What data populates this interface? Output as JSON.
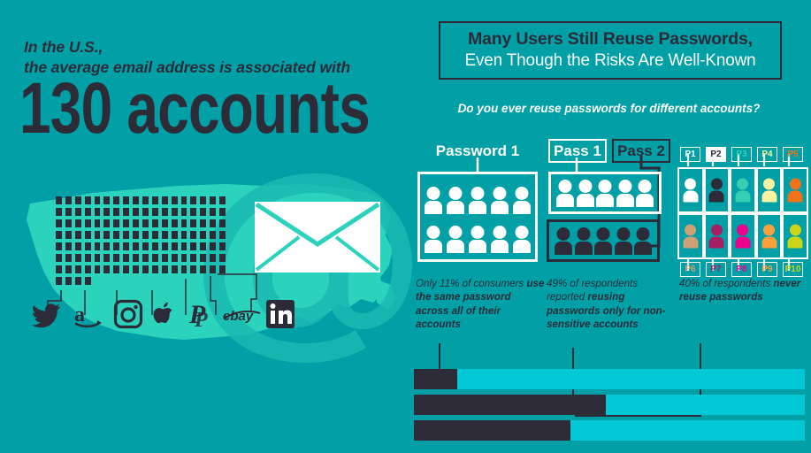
{
  "colors": {
    "background_teal": "#00a0a6",
    "map_teal": "#2bd3bd",
    "dark": "#2e2b38",
    "white": "#ffffff",
    "bar_track": "#00c8d4",
    "bar_fill": "#2e2b38"
  },
  "left": {
    "lede_line1": "In the U.S.,",
    "lede_line2": "the average email address is associated with",
    "big_number": "130 accounts",
    "dot_count": 130,
    "map_name": "united-states-map",
    "envelope_name": "envelope-icon",
    "brands": [
      {
        "name": "twitter-icon",
        "label": "Twitter"
      },
      {
        "name": "amazon-icon",
        "label": "Amazon"
      },
      {
        "name": "instagram-icon",
        "label": "Instagram"
      },
      {
        "name": "apple-icon",
        "label": "Apple"
      },
      {
        "name": "paypal-icon",
        "label": "PayPal"
      },
      {
        "name": "ebay-icon",
        "label": "eBay"
      },
      {
        "name": "linkedin-icon",
        "label": "LinkedIn"
      }
    ]
  },
  "right": {
    "title_line1": "Many Users Still Reuse Passwords,",
    "title_line2": "Even Though the Risks Are Well-Known",
    "question": "Do you ever reuse passwords for different accounts?",
    "groups": [
      {
        "label": "Password 1",
        "style": "plain",
        "people": 10,
        "person_color": "#ffffff",
        "box": "white"
      },
      {
        "label": "Pass 1",
        "style": "boxedwhite",
        "people": 5,
        "person_color": "#ffffff",
        "box": "white"
      },
      {
        "label": "Pass 2",
        "style": "boxeddark",
        "people": 5,
        "person_color": "#2e2b38",
        "box": "dark"
      }
    ],
    "password_grid": [
      {
        "tag": "P1",
        "color": "#ffffff",
        "tag_color": "#ffffff",
        "tag_on_white": false
      },
      {
        "tag": "P2",
        "color": "#2e2b38",
        "tag_color": "#2e2b38",
        "tag_on_white": true
      },
      {
        "tag": "P3",
        "color": "#35cfb6",
        "tag_color": "#35cfb6",
        "tag_on_white": false
      },
      {
        "tag": "P4",
        "color": "#f7f3a0",
        "tag_color": "#f7f3a0",
        "tag_on_white": false
      },
      {
        "tag": "P5",
        "color": "#f2721c",
        "tag_color": "#f2721c",
        "tag_on_white": false
      },
      {
        "tag": "P6",
        "color": "#cda174",
        "tag_color": "#cda174",
        "tag_on_white": false
      },
      {
        "tag": "P7",
        "color": "#a81e63",
        "tag_color": "#a81e63",
        "tag_on_white": false
      },
      {
        "tag": "P8",
        "color": "#ec008c",
        "tag_color": "#ec008c",
        "tag_on_white": false
      },
      {
        "tag": "P9",
        "color": "#f9a03c",
        "tag_color": "#f9a03c",
        "tag_on_white": false
      },
      {
        "tag": "P10",
        "color": "#ccd419",
        "tag_color": "#ccd419",
        "tag_on_white": false
      }
    ],
    "captions": [
      {
        "plain1": "Only 11% of consumers ",
        "bold": "use the same password across all of their accounts",
        "plain2": ""
      },
      {
        "plain1": "49% of respondents reported ",
        "bold": "reusing passwords only for non-sensitive accounts",
        "plain2": ""
      },
      {
        "plain1": "40% of respondents ",
        "bold": "never reuse passwords",
        "plain2": ""
      }
    ]
  },
  "chart_data": {
    "type": "bar",
    "orientation": "horizontal",
    "title": "Do you ever reuse passwords for different accounts?",
    "categories": [
      "Use the same password across all of their accounts",
      "Reuse passwords only for non-sensitive accounts",
      "Never reuse passwords"
    ],
    "values": [
      11,
      49,
      40
    ],
    "value_labels": [
      "11%",
      "49%",
      "40%"
    ],
    "xlabel": "",
    "ylabel": "",
    "xlim": [
      0,
      100
    ],
    "unit": "percent of respondents",
    "grid": false,
    "legend": false,
    "series_color": "#2e2b38",
    "track_color": "#00c8d4"
  }
}
